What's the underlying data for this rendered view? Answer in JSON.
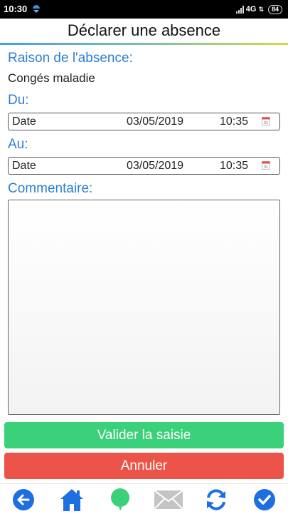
{
  "status_bar": {
    "time": "10:30",
    "network": "4G",
    "battery": "84"
  },
  "header": {
    "title": "Déclarer une absence"
  },
  "form": {
    "reason_label": "Raison de l'absence:",
    "reason_value": "Congés maladie",
    "from_label": "Du:",
    "from": {
      "field_label": "Date",
      "date": "03/05/2019",
      "time": "10:35"
    },
    "to_label": "Au:",
    "to": {
      "field_label": "Date",
      "date": "03/05/2019",
      "time": "10:35"
    },
    "comment_label": "Commentaire:",
    "comment_value": ""
  },
  "buttons": {
    "validate": "Valider la saisie",
    "cancel": "Annuler"
  },
  "bottom_nav": [
    {
      "icon": "back-arrow-icon"
    },
    {
      "icon": "home-icon"
    },
    {
      "icon": "speech-bubble-icon"
    },
    {
      "icon": "mail-icon"
    },
    {
      "icon": "sync-icon"
    },
    {
      "icon": "check-icon"
    }
  ],
  "colors": {
    "label_blue": "#2b7fd4",
    "validate_green": "#3bd07a",
    "cancel_red": "#ec5449",
    "nav_blue": "#1e6fe0",
    "nav_green": "#3bd07a",
    "nav_gray": "#c4c4c4"
  }
}
